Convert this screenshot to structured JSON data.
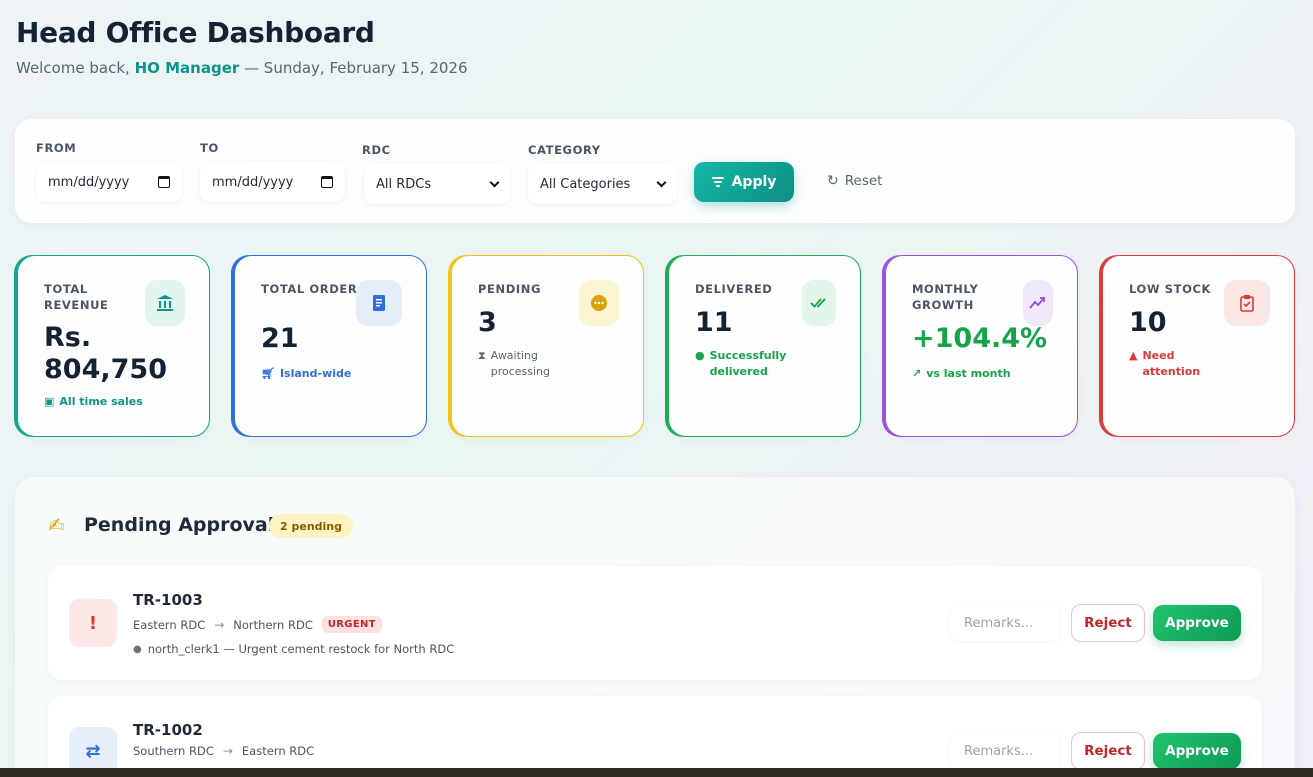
{
  "header": {
    "title": "Head Office Dashboard",
    "welcome_prefix": "Welcome back, ",
    "user": "HO Manager",
    "date_text": " — Sunday, February 15, 2026"
  },
  "filters": {
    "from_label": "FROM",
    "from_value": "mm/dd/yyyy",
    "to_label": "TO",
    "to_value": "mm/dd/yyyy",
    "rdc_label": "RDC",
    "rdc_value": "All RDCs",
    "category_label": "CATEGORY",
    "category_value": "All Categories",
    "apply_label": "Apply",
    "reset_label": "Reset"
  },
  "stats": [
    {
      "label": "TOTAL REVENUE",
      "value": "Rs. 804,750",
      "sub": "All time sales",
      "icon": "bank-icon",
      "color": "#14a38b"
    },
    {
      "label": "TOTAL ORDERS",
      "value": "21",
      "sub": "Island-wide",
      "icon": "receipt-icon",
      "color": "#2f6fd6"
    },
    {
      "label": "PENDING",
      "value": "3",
      "sub": "Awaiting processing",
      "icon": "more-icon",
      "color": "#f2c21b"
    },
    {
      "label": "DELIVERED",
      "value": "11",
      "sub": "Successfully delivered",
      "icon": "double-check-icon",
      "color": "#1faa55"
    },
    {
      "label": "MONTHLY GROWTH",
      "value": "+104.4%",
      "sub": "vs last month",
      "icon": "trend-icon",
      "color": "#9b4fd8"
    },
    {
      "label": "LOW STOCK",
      "value": "10",
      "sub": "Need attention",
      "icon": "clipboard-icon",
      "color": "#d93a3a"
    }
  ],
  "approvals": {
    "title": "Pending Approvals",
    "count_badge": "2 pending",
    "items": [
      {
        "id": "TR-1003",
        "from": "Eastern RDC",
        "to": "Northern RDC",
        "tag": "URGENT",
        "note": "north_clerk1 — Urgent cement restock for North RDC",
        "remarks_placeholder": "Remarks...",
        "reject_label": "Reject",
        "approve_label": "Approve"
      },
      {
        "id": "TR-1002",
        "from": "Southern RDC",
        "to": "Eastern RDC",
        "remarks_placeholder": "Remarks...",
        "reject_label": "Reject",
        "approve_label": "Approve"
      }
    ]
  }
}
